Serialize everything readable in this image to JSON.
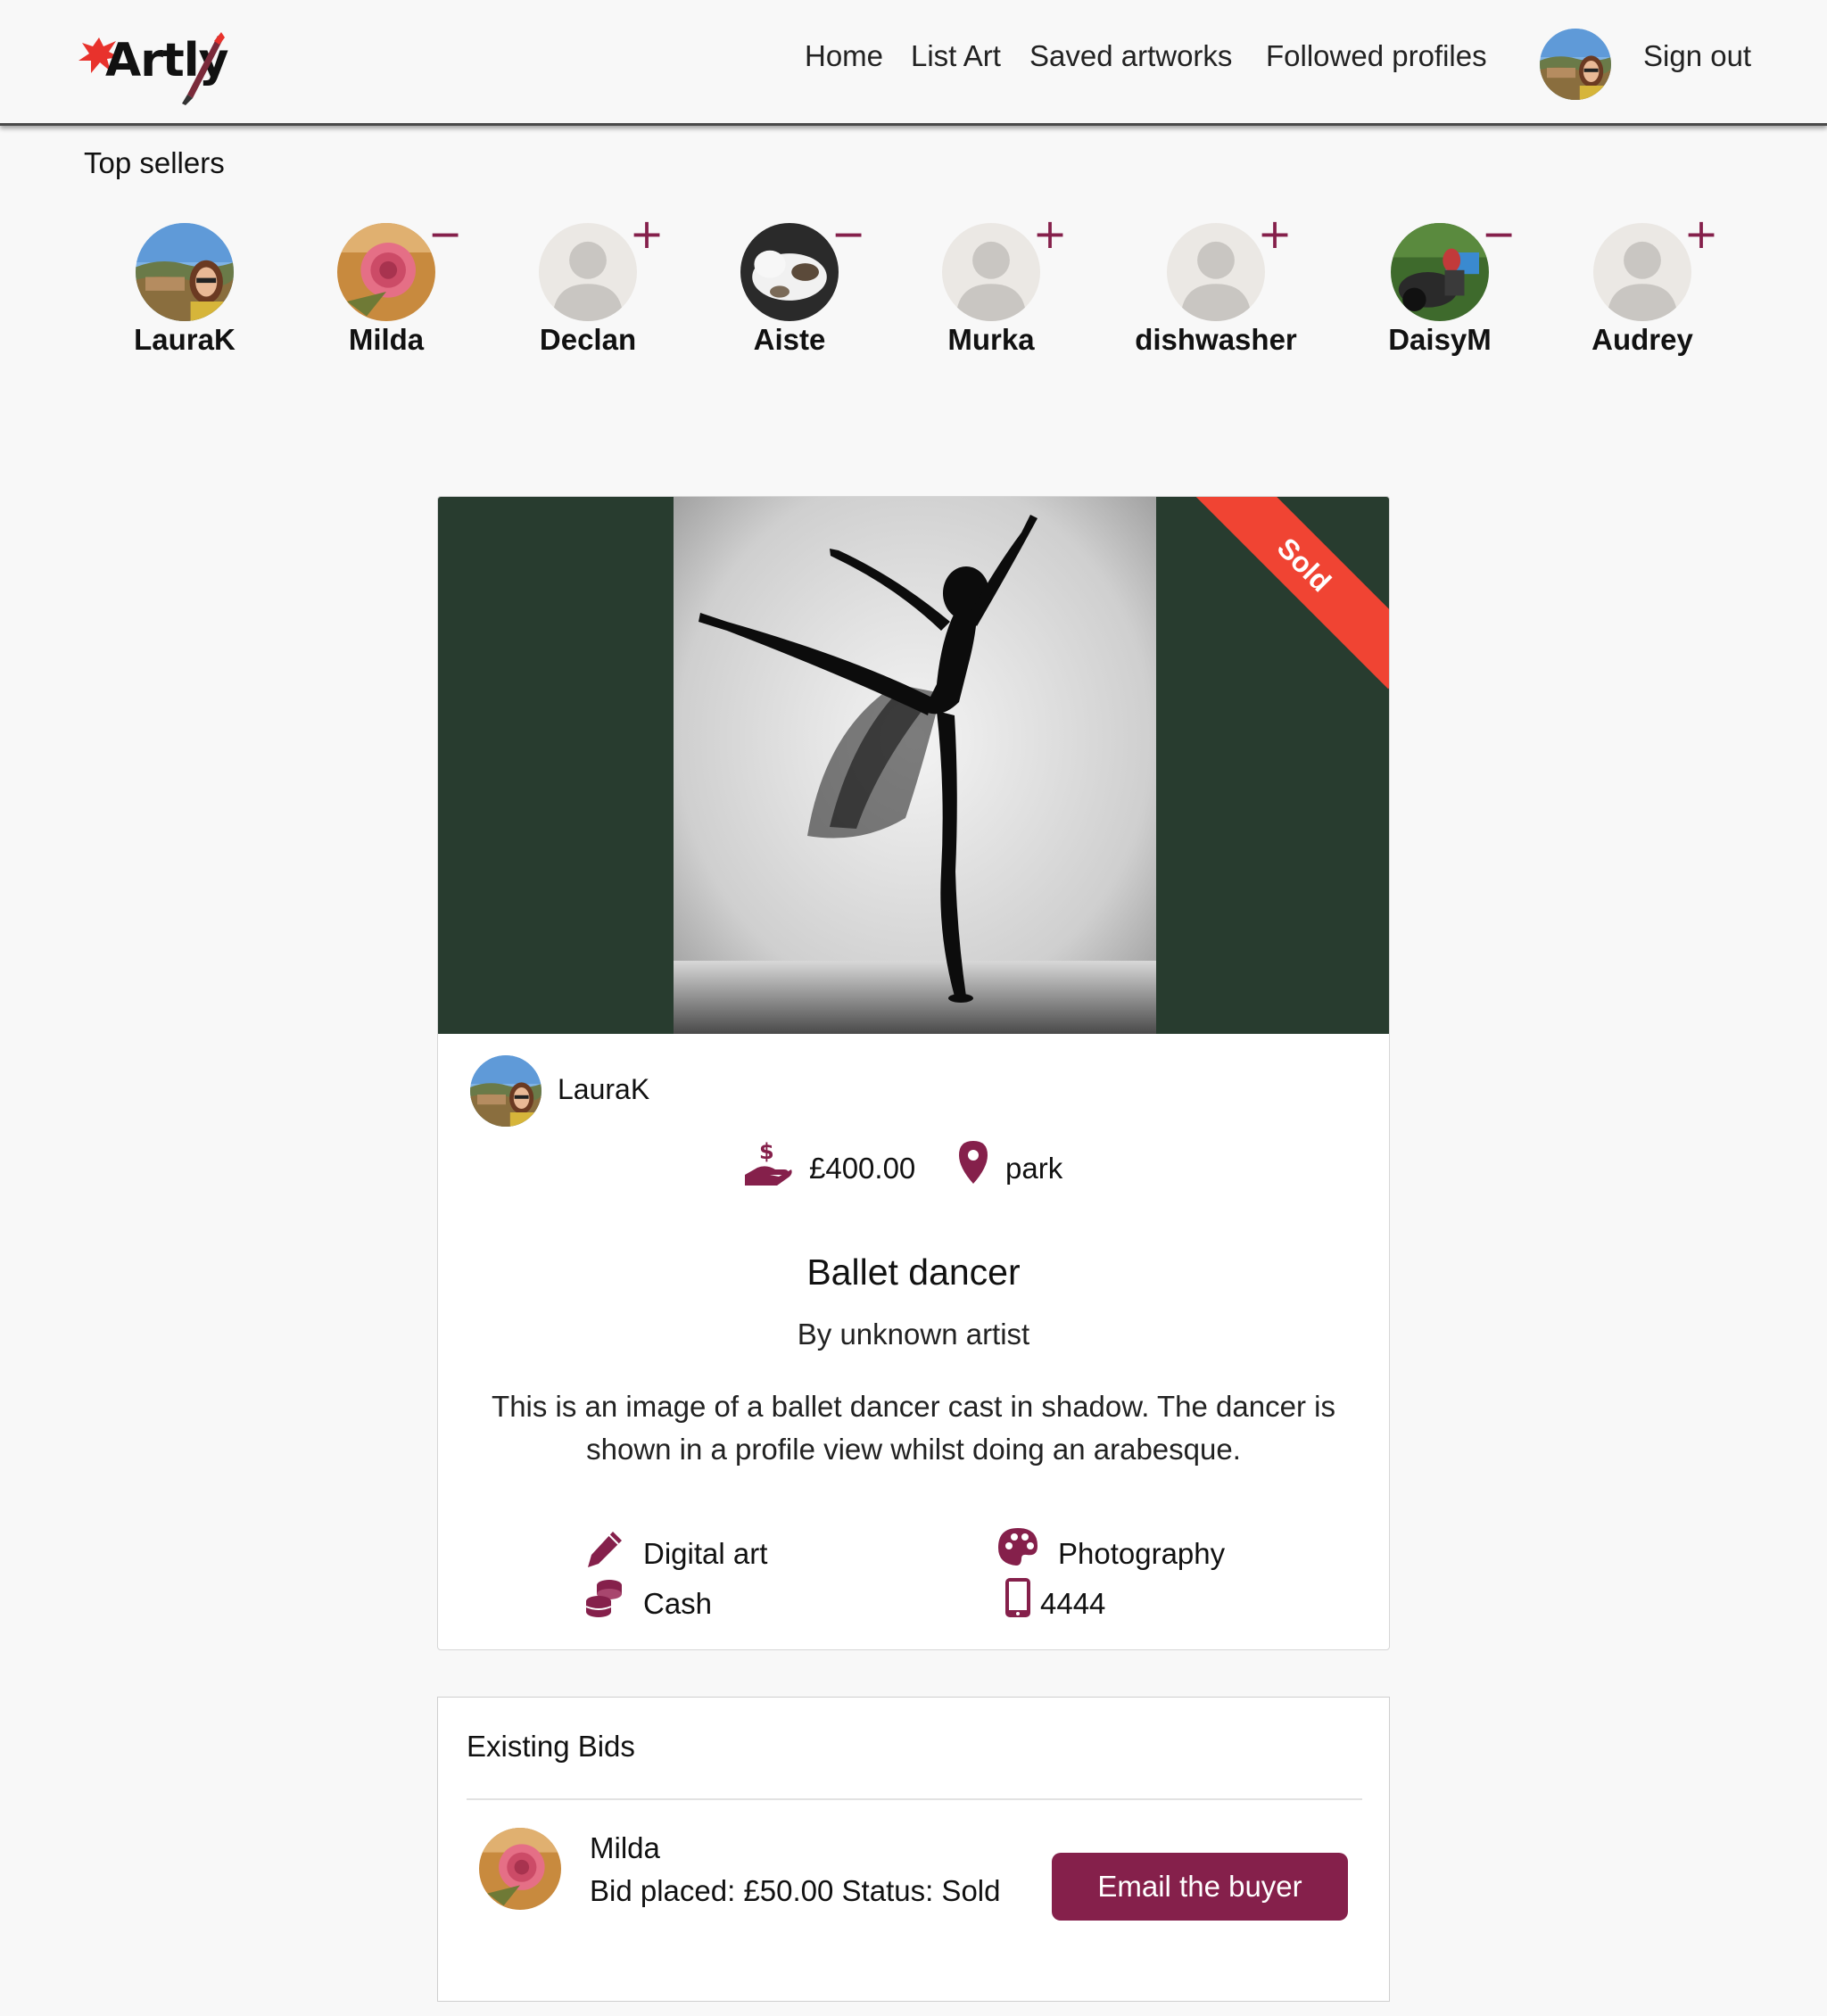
{
  "nav": {
    "logo_text": "Artly",
    "links": [
      "Home",
      "List Art",
      "Saved artworks",
      "Followed profiles"
    ],
    "sign_out": "Sign out"
  },
  "top_sellers": {
    "title": "Top sellers",
    "sellers": [
      {
        "name": "LauraK",
        "avatar": "landscape-portrait",
        "follow": ""
      },
      {
        "name": "Milda",
        "avatar": "rose",
        "follow": "−"
      },
      {
        "name": "Declan",
        "avatar": "default",
        "follow": "+"
      },
      {
        "name": "Aiste",
        "avatar": "cat",
        "follow": "−"
      },
      {
        "name": "Murka",
        "avatar": "default",
        "follow": "+"
      },
      {
        "name": "dishwasher",
        "avatar": "default",
        "follow": "+"
      },
      {
        "name": "DaisyM",
        "avatar": "motorbike",
        "follow": "−"
      },
      {
        "name": "Audrey",
        "avatar": "default",
        "follow": "+"
      }
    ]
  },
  "artwork": {
    "status_ribbon": "Sold",
    "owner": "LauraK",
    "price": "£400.00",
    "location": "park",
    "title": "Ballet dancer",
    "artist": "By unknown artist",
    "description": "This is an image of a ballet dancer cast in shadow. The dancer is shown in a profile view whilst doing an arabesque.",
    "medium": "Digital art",
    "category": "Photography",
    "payment": "Cash",
    "phone": "4444"
  },
  "bids": {
    "title": "Existing Bids",
    "items": [
      {
        "user": "Milda",
        "info": "Bid placed: £50.00 Status: Sold",
        "action": "Email the buyer"
      }
    ]
  },
  "colors": {
    "accent": "#85204b",
    "ribbon": "#f04433",
    "image_bg": "#283c2f",
    "page_bg": "#f8f8f8"
  },
  "icons": {
    "price": "hand-holding-dollar-icon",
    "location": "map-pin-icon",
    "medium": "pencil-icon",
    "category": "palette-icon",
    "payment": "coins-icon",
    "phone": "mobile-phone-icon"
  }
}
